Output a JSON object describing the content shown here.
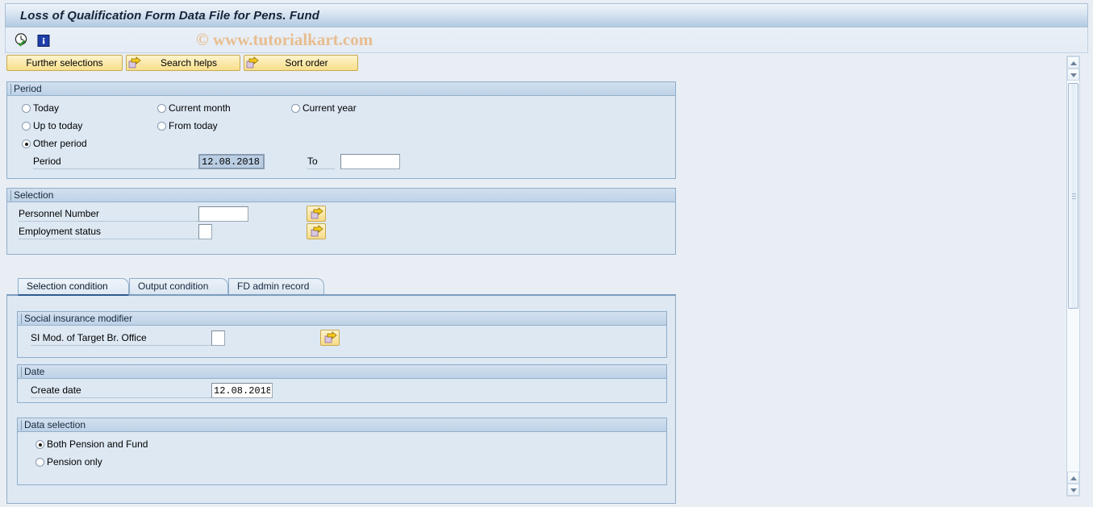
{
  "window": {
    "title": "Loss of Qualification Form Data File for Pens. Fund"
  },
  "watermark": "© www.tutorialkart.com",
  "toolbar": {
    "execute_icon": "clock-check-icon",
    "info_icon": "information-icon"
  },
  "buttons": [
    {
      "label": "Further selections",
      "icon": null
    },
    {
      "label": "Search helps",
      "icon": "yellow-arrow-icon"
    },
    {
      "label": "Sort order",
      "icon": "yellow-arrow-icon"
    }
  ],
  "period_group": {
    "title": "Period",
    "radios": [
      {
        "label": "Today",
        "selected": false
      },
      {
        "label": "Current month",
        "selected": false
      },
      {
        "label": "Current year",
        "selected": false
      },
      {
        "label": "Up to today",
        "selected": false
      },
      {
        "label": "From today",
        "selected": false
      },
      {
        "label": "Other period",
        "selected": true
      }
    ],
    "period_label": "Period",
    "period_value": "12.08.2018",
    "to_label": "To",
    "to_value": ""
  },
  "selection_group": {
    "title": "Selection",
    "fields": [
      {
        "label": "Personnel Number",
        "value": "",
        "multi_icon": "yellow-arrow-icon"
      },
      {
        "label": "Employment status",
        "value": "",
        "multi_icon": "yellow-arrow-icon"
      }
    ]
  },
  "tabs": [
    {
      "label": "Selection condition",
      "active": true
    },
    {
      "label": "Output condition",
      "active": false
    },
    {
      "label": "FD admin record",
      "active": false
    }
  ],
  "si_group": {
    "title": "Social insurance modifier",
    "field_label": "SI Mod. of Target Br. Office",
    "field_value": "",
    "multi_icon": "yellow-arrow-icon"
  },
  "date_group": {
    "title": "Date",
    "field_label": "Create date",
    "field_value": "12.08.2018"
  },
  "data_selection_group": {
    "title": "Data selection",
    "radios": [
      {
        "label": "Both Pension and Fund",
        "selected": true
      },
      {
        "label": "Pension only",
        "selected": false
      }
    ]
  },
  "scrollbars": {
    "outer_up": "scroll-up-arrow",
    "outer_down": "scroll-down-arrow"
  },
  "colors": {
    "accent": "#2e5a8e",
    "panel": "#dde8f3",
    "button": "#fbe9ab",
    "watermark": "#e8bd8f"
  }
}
